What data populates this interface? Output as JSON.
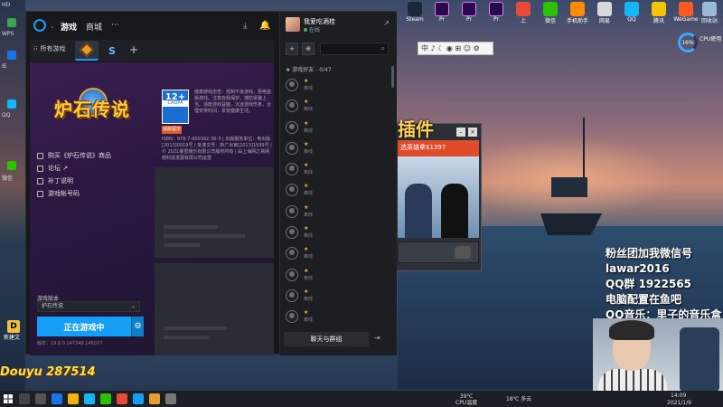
{
  "app": {
    "nav": {
      "games": "游戏",
      "shop": "商城",
      "more": "···"
    }
  },
  "game_tabs": {
    "all_games": "所有游戏",
    "add": "+"
  },
  "hero": {
    "logo_text": "炉石传说",
    "links": [
      "购买《炉石传说》商品",
      "论坛 ↗",
      "补丁说明",
      "游戏帐号码"
    ],
    "rating": {
      "age": "12+",
      "cadpa": "CADPA",
      "note": "适龄提示",
      "desc": "健康游戏忠告：抵制不良游戏，拒绝盗版游戏。注意自我保护，谨防受骗上当。适度游戏益脑，沉迷游戏伤身。合理安排时间，享受健康生活。",
      "legal": "ISBN：978-7-900392-36-3 | 出版服务单位：电出版[2013]0019号 | 批准文号：新广出审[2013]1599号 | © 2021暴雪娱乐有限公司版权所有 | 由上海网之易网络科技发展有限公司运营"
    },
    "region_label": "游戏版本",
    "region_value": "炉石传说",
    "play_label": "正在游戏中",
    "version": "版本：19.8.0.147348.145077"
  },
  "friends": {
    "me_name": "我爱吃酒桂",
    "me_status": "在线",
    "section": "★ 游戏好友 - 0/47",
    "item_status": "离线",
    "chat_button": "聊天与群组",
    "count": 13
  },
  "desktop": {
    "icons": [
      "Steam",
      "Pr",
      "Pr",
      "Pr",
      "上",
      "微信",
      "手机助手",
      "网易",
      "QQ",
      "腾讯",
      "WeGame",
      "回收站"
    ],
    "ime": "中 ♪ ☾ ◉ ⊞ ☺ ⚙",
    "cpu_percent": "16%",
    "cpu_label": "CPU使用",
    "left_labels": [
      "HD",
      "WPS",
      "IE",
      "QQ",
      "微信"
    ],
    "douyu_number": "Douyu 287514",
    "douyu_avatar": "D",
    "desk_small": "新建文"
  },
  "plugin": {
    "title": "插件",
    "banner": "选英雄拿$1397"
  },
  "overlay_lines": [
    "粉丝团加我微信号",
    "lawar2016",
    "QQ群 1922565",
    "电脑配置在鱼吧",
    "QQ音乐：里子的音乐盒"
  ],
  "taskbar": {
    "temp": "39℃\nCPU温度",
    "weather": "18℃ 多云",
    "time": "14:09",
    "date": "2021/1/9"
  }
}
